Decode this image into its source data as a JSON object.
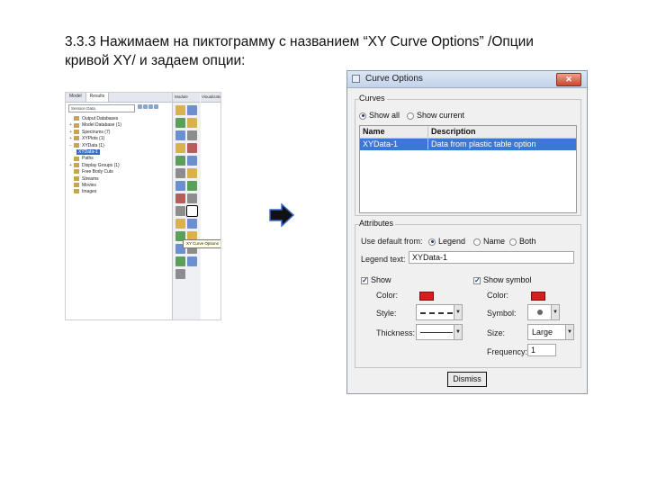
{
  "slide": {
    "title_line1": "3.3.3 Нажимаем на пиктограмму с названием “XY Curve Options” /Опции",
    "title_line2": "кривой XY/ и задаем опции:"
  },
  "left_screenshot": {
    "tabs": [
      "Model",
      "Results"
    ],
    "search_text": "Session Data",
    "tree": [
      {
        "label": "Output Databases",
        "level": 0
      },
      {
        "label": "Model Database (1)",
        "level": 0
      },
      {
        "label": "Spectrums (7)",
        "level": 0
      },
      {
        "label": "XYPlots (1)",
        "level": 0
      },
      {
        "label": "XYData (1)",
        "level": 0
      },
      {
        "label": "XYData-1",
        "level": 1,
        "selected": true
      },
      {
        "label": "Paths",
        "level": 0
      },
      {
        "label": "Display Groups (1)",
        "level": 0
      },
      {
        "label": "Free Body Cuts",
        "level": 0
      },
      {
        "label": "Streams",
        "level": 0
      },
      {
        "label": "Movies",
        "level": 0
      },
      {
        "label": "Images",
        "level": 0
      }
    ],
    "toolbar_header": "Module",
    "viewport_header": "Visualization",
    "tooltip": "XY Curve Options"
  },
  "dialog": {
    "title": "Curve Options",
    "close_icon": "x-icon",
    "curves_group": "Curves",
    "show_all": "Show all",
    "show_current": "Show current",
    "table_headers": [
      "Name",
      "Description"
    ],
    "table_rows": [
      {
        "name": "XYData-1",
        "description": "Data from plastic table option"
      }
    ],
    "attributes_group": "Attributes",
    "use_default_label": "Use default from:",
    "opt_legend": "Legend",
    "opt_name": "Name",
    "opt_both": "Both",
    "legend_text_label": "Legend text:",
    "legend_text_value": "XYData-1",
    "show_line_label": "Show",
    "show_symbol_label": "Show symbol",
    "line_color_label": "Color:",
    "line_style_label": "Style:",
    "line_thickness_label": "Thickness:",
    "sym_color_label": "Color:",
    "sym_symbol_label": "Symbol:",
    "sym_size_label": "Size:",
    "sym_size_value": "Large",
    "sym_frequency_label": "Frequency:",
    "sym_frequency_value": "1",
    "line_color": "#d81d1d",
    "symbol_color": "#d81d1d",
    "dismiss_label": "Dismiss"
  }
}
